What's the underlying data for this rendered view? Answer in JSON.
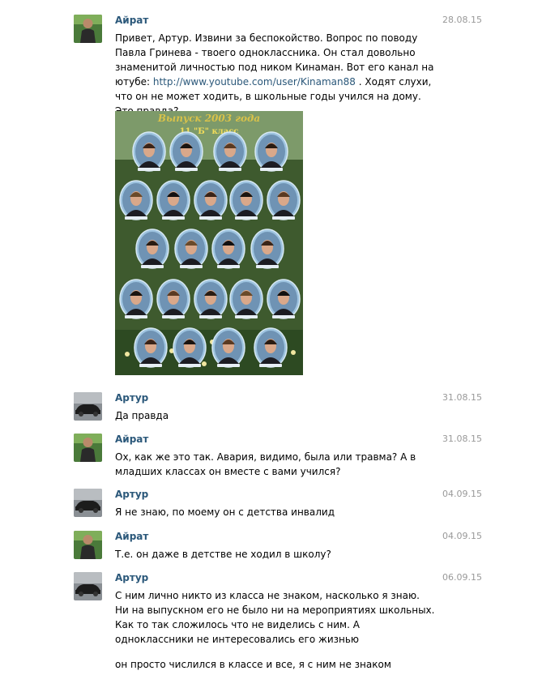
{
  "messages": [
    {
      "author": "Айрат",
      "date": "28.08.15",
      "text_before_link": "Привет, Артур.   Извини за беспокойство. Вопрос по поводу Павла Гринева - твоего одноклассника. Он стал довольно знаменитой личностью под ником Кинаман. Вот его канал на ютубе: ",
      "link": "http://www.youtube.com/user/Kinaman88",
      "text_after_link": " . Ходят слухи, что он не может ходить, в школьные годы учился на дому. Это правда?",
      "photo": {
        "banner": "Выпуск 2003 года",
        "class_label": "11 \"Б\" класс"
      }
    },
    {
      "author": "Артур",
      "date": "31.08.15",
      "text": "Да правда"
    },
    {
      "author": "Айрат",
      "date": "31.08.15",
      "text": "Ох, как же это так. Авария, видимо, была или травма? А в младших классах он вместе с вами учился?"
    },
    {
      "author": "Артур",
      "date": "04.09.15",
      "text": "Я не знаю, по моему он с детства инвалид"
    },
    {
      "author": "Айрат",
      "date": "04.09.15",
      "text": "Т.е. он даже в детстве не ходил в школу?"
    },
    {
      "author": "Артур",
      "date": "06.09.15",
      "text": "С ним лично никто из класса не знаком, насколько я знаю. Ни на выпускном его не было ни на мероприятиях школьных. Как то так сложилось что не виделись с ним. А одноклассники не интересовались его жизнью",
      "text2": "он просто числился в классе и все, я с ним не знаком"
    }
  ],
  "colors": {
    "author": "#2b587a",
    "date": "#999999",
    "link": "#2b587a",
    "photo_bg": "#3e5a2e",
    "oval_frame": "#9ec4e0"
  },
  "icons": {
    "airat_avatar": "man-portrait",
    "artur_avatar": "car-photo"
  }
}
